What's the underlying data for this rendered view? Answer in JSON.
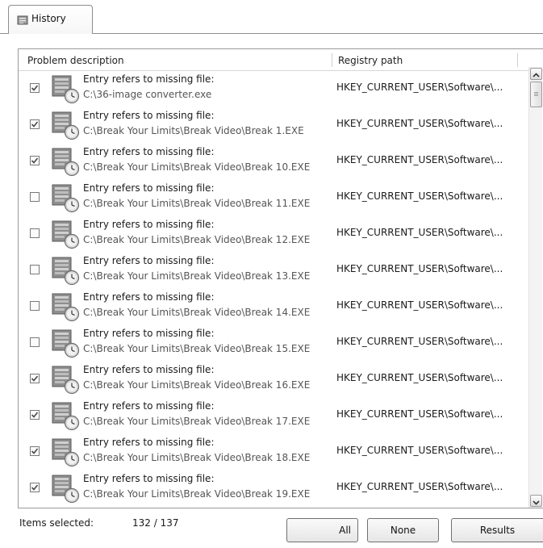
{
  "tabs": [
    {
      "label": "History",
      "icon": "history-icon"
    }
  ],
  "columns": {
    "description": "Problem description",
    "registry": "Registry path"
  },
  "rows": [
    {
      "checked": true,
      "title": "Entry refers to missing file:",
      "path": "C:\\36-image converter.exe",
      "registry": "HKEY_CURRENT_USER\\Software\\..."
    },
    {
      "checked": true,
      "title": "Entry refers to missing file:",
      "path": "C:\\Break Your Limits\\Break Video\\Break 1.EXE",
      "registry": "HKEY_CURRENT_USER\\Software\\..."
    },
    {
      "checked": true,
      "title": "Entry refers to missing file:",
      "path": "C:\\Break Your Limits\\Break Video\\Break 10.EXE",
      "registry": "HKEY_CURRENT_USER\\Software\\..."
    },
    {
      "checked": false,
      "title": "Entry refers to missing file:",
      "path": "C:\\Break Your Limits\\Break Video\\Break 11.EXE",
      "registry": "HKEY_CURRENT_USER\\Software\\..."
    },
    {
      "checked": false,
      "title": "Entry refers to missing file:",
      "path": "C:\\Break Your Limits\\Break Video\\Break 12.EXE",
      "registry": "HKEY_CURRENT_USER\\Software\\..."
    },
    {
      "checked": false,
      "title": "Entry refers to missing file:",
      "path": "C:\\Break Your Limits\\Break Video\\Break 13.EXE",
      "registry": "HKEY_CURRENT_USER\\Software\\..."
    },
    {
      "checked": false,
      "title": "Entry refers to missing file:",
      "path": "C:\\Break Your Limits\\Break Video\\Break 14.EXE",
      "registry": "HKEY_CURRENT_USER\\Software\\..."
    },
    {
      "checked": false,
      "title": "Entry refers to missing file:",
      "path": "C:\\Break Your Limits\\Break Video\\Break 15.EXE",
      "registry": "HKEY_CURRENT_USER\\Software\\..."
    },
    {
      "checked": true,
      "title": "Entry refers to missing file:",
      "path": "C:\\Break Your Limits\\Break Video\\Break 16.EXE",
      "registry": "HKEY_CURRENT_USER\\Software\\..."
    },
    {
      "checked": true,
      "title": "Entry refers to missing file:",
      "path": "C:\\Break Your Limits\\Break Video\\Break 17.EXE",
      "registry": "HKEY_CURRENT_USER\\Software\\..."
    },
    {
      "checked": true,
      "title": "Entry refers to missing file:",
      "path": "C:\\Break Your Limits\\Break Video\\Break 18.EXE",
      "registry": "HKEY_CURRENT_USER\\Software\\..."
    },
    {
      "checked": true,
      "title": "Entry refers to missing file:",
      "path": "C:\\Break Your Limits\\Break Video\\Break 19.EXE",
      "registry": "HKEY_CURRENT_USER\\Software\\..."
    }
  ],
  "footer": {
    "items_label": "Items selected:",
    "items_count": "132 / 137",
    "buttons": {
      "all": "All",
      "none": "None",
      "results": "Results"
    }
  },
  "colors": {
    "border": "#8d8d8d",
    "check": "#4a4a4a",
    "background": "#ffffff"
  }
}
